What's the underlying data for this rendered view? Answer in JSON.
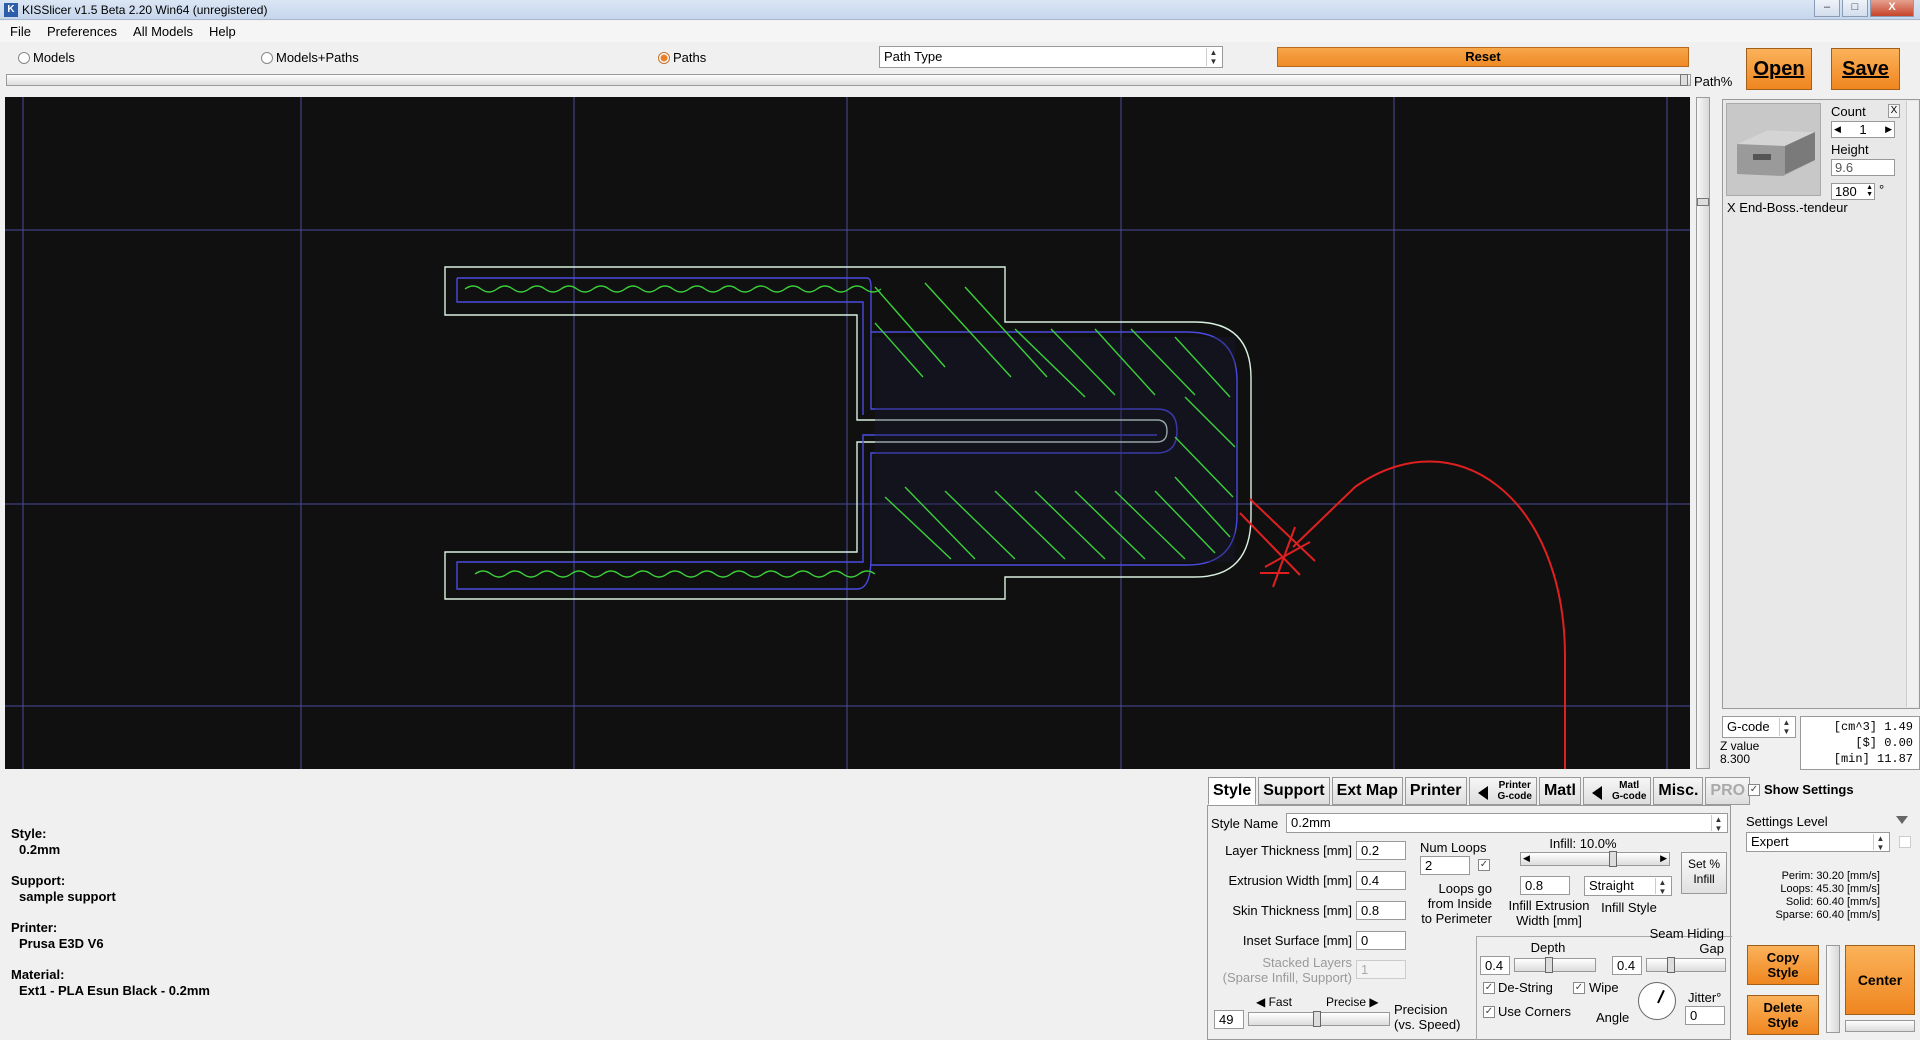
{
  "window": {
    "title": "KISSlicer v1.5 Beta 2.20 Win64 (unregistered)",
    "app_icon": "K",
    "min": "–",
    "max": "□",
    "close": "X"
  },
  "menu": [
    "File",
    "Preferences",
    "All Models",
    "Help"
  ],
  "toolbar": {
    "view_modes": [
      "Models",
      "Models+Paths",
      "Paths"
    ],
    "selected_mode": "Paths",
    "path_type": "Path Type",
    "reset": "Reset",
    "open": "Open",
    "save": "Save",
    "path_pct_label": "Path%"
  },
  "colors": {
    "accent": "#ef8a25",
    "viewport_bg": "#101010",
    "grid": "#4a4a9a",
    "perimeter": "#d8f0e0",
    "inner_loop": "#4a4ae0",
    "infill": "#3ad03a",
    "annotation": "#e02020"
  },
  "model": {
    "count_label": "Count",
    "count": "1",
    "height_label": "Height",
    "height": "9.6",
    "rotation": "180",
    "rotation_unit": "°",
    "name": "X End-Boss.-tendeur"
  },
  "gcode": {
    "selector": "G-code",
    "z_label": "Z value",
    "z_value": "8.300",
    "stats": [
      "[cm^3] 1.49",
      "[$] 0.00",
      "[min] 11.87"
    ]
  },
  "summary": [
    {
      "label": "Style:",
      "value": "0.2mm"
    },
    {
      "label": "Support:",
      "value": "sample support"
    },
    {
      "label": "Printer:",
      "value": "Prusa E3D V6"
    },
    {
      "label": "Material:",
      "value": "Ext1 - PLA Esun Black - 0.2mm"
    }
  ],
  "tabs": {
    "style": "Style",
    "support": "Support",
    "ext_map": "Ext Map",
    "printer": "Printer",
    "printer_gcode_1": "Printer",
    "printer_gcode_2": "G-code",
    "matl": "Matl",
    "matl_gcode_1": "Matl",
    "matl_gcode_2": "G-code",
    "misc": "Misc.",
    "pro": "PRO"
  },
  "style": {
    "style_name_label": "Style Name",
    "style_name": "0.2mm",
    "layer_thickness_label": "Layer Thickness [mm]",
    "layer_thickness": "0.2",
    "extrusion_width_label": "Extrusion Width [mm]",
    "extrusion_width": "0.4",
    "skin_thickness_label": "Skin Thickness [mm]",
    "skin_thickness": "0.8",
    "inset_surface_label": "Inset  Surface [mm]",
    "inset_surface": "0",
    "stacked_layers_label_1": "Stacked Layers",
    "stacked_layers_label_2": "(Sparse Infill, Support)",
    "stacked_layers": "1",
    "fast_label": "Fast",
    "precise_label": "Precise",
    "precision_value": "49",
    "precision_label_1": "Precision",
    "precision_label_2": "(vs. Speed)",
    "num_loops_label": "Num Loops",
    "num_loops": "2",
    "loops_go_1": "Loops go",
    "loops_go_2": "from Inside",
    "loops_go_3": "to Perimeter",
    "infill_label": "Infill: 10.0%",
    "set_pct_1": "Set %",
    "set_pct_2": "Infill",
    "infill_extrusion_width": "0.8",
    "infill_extrusion_label_1": "Infill Extrusion",
    "infill_extrusion_label_2": "Width [mm]",
    "infill_style": "Straight",
    "infill_style_label": "Infill Style",
    "depth_label": "Depth",
    "depth": "0.4",
    "seam_label_1": "Seam Hiding",
    "seam_label_2": "Gap",
    "seam_gap": "0.4",
    "destring_label": "De-String",
    "wipe_label": "Wipe",
    "use_corners_label": "Use Corners",
    "angle_label": "Angle",
    "jitter_label": "Jitter°",
    "jitter": "0"
  },
  "right_settings": {
    "show_settings": "Show Settings",
    "level_label": "Settings Level",
    "level": "Expert",
    "speeds": [
      "Perim: 30.20 [mm/s]",
      "Loops: 45.30 [mm/s]",
      "Solid: 60.40 [mm/s]",
      "Sparse: 60.40 [mm/s]"
    ],
    "copy_style_1": "Copy",
    "copy_style_2": "Style",
    "delete_style_1": "Delete",
    "delete_style_2": "Style",
    "center": "Center"
  }
}
